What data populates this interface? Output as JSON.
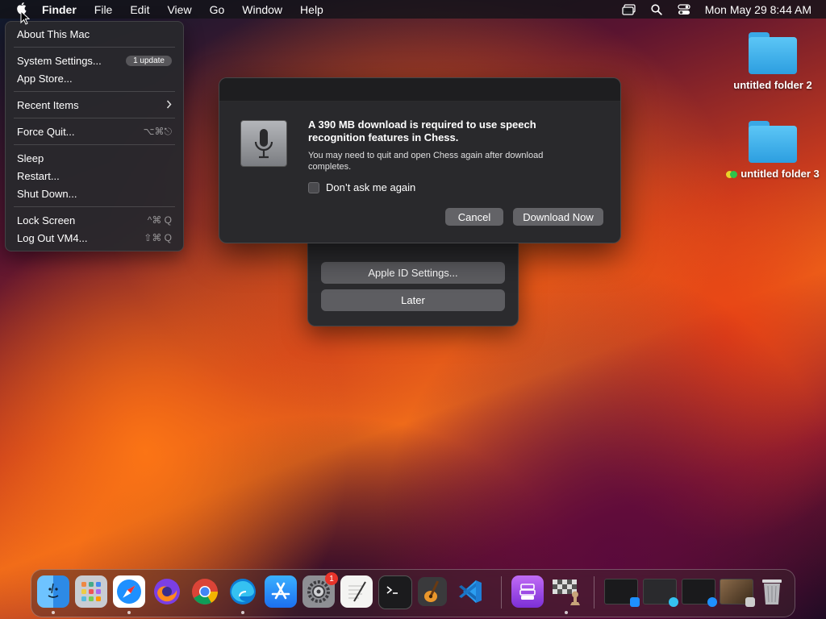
{
  "menubar": {
    "app_name": "Finder",
    "menus": [
      "File",
      "Edit",
      "View",
      "Go",
      "Window",
      "Help"
    ],
    "clock": "Mon May 29  8:44 AM",
    "status_icons": [
      "screen-mirroring-icon",
      "search-icon",
      "control-center-icon"
    ]
  },
  "apple_menu": {
    "about": "About This Mac",
    "system_settings": "System Settings...",
    "update_badge": "1 update",
    "app_store": "App Store...",
    "recent_items": "Recent Items",
    "force_quit": "Force Quit...",
    "force_quit_shortcut": "⌥⌘⎋",
    "sleep": "Sleep",
    "restart": "Restart...",
    "shut_down": "Shut Down...",
    "lock_screen": "Lock Screen",
    "lock_screen_shortcut": "^⌘ Q",
    "log_out": "Log Out VM4...",
    "log_out_shortcut": "⇧⌘ Q"
  },
  "speech_dialog": {
    "title": "A 390 MB download is required to use speech recognition features in Chess.",
    "body": "You may need to quit and open Chess again after download completes.",
    "checkbox_label": "Don’t ask me again",
    "cancel_label": "Cancel",
    "download_label": "Download Now"
  },
  "apple_id_dialog": {
    "settings_label": "Apple ID Settings...",
    "later_label": "Later"
  },
  "desktop": {
    "folder1": "untitled folder 2",
    "folder2": "untitled folder 3",
    "tag_colors": [
      "#e8d42a",
      "#2ec44a"
    ]
  },
  "dock": {
    "apps": [
      "Finder",
      "Launchpad",
      "Safari",
      "Firefox",
      "Chrome",
      "Edge",
      "App Store",
      "System Settings",
      "TextEdit",
      "Terminal",
      "GarageBand",
      "Visual Studio Code",
      "Podcasts",
      "Chess"
    ],
    "settings_badge": "1",
    "accent_colors": {
      "finder": "#2d8ae6",
      "safari": "#1e90ff",
      "vscode": "#1f7fd6"
    }
  }
}
